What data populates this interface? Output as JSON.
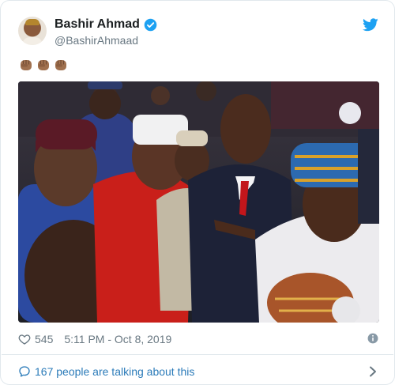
{
  "tweet": {
    "author": {
      "display_name": "Bashir Ahmad",
      "handle": "@BashirAhmaad",
      "verified": true
    },
    "text_emoji": [
      "raised-fist-medium-dark",
      "raised-fist-medium-dark",
      "raised-fist-medium-dark"
    ],
    "likes": "545",
    "timestamp": "5:11 PM - Oct 8, 2019",
    "conversation_label": "167 people are talking about this"
  },
  "colors": {
    "twitter_blue": "#1da1f2",
    "link_blue": "#2b7bb9",
    "meta_gray": "#697882",
    "divider": "#e1e8ed",
    "fist_skin": "#a0714f"
  },
  "icons": {
    "logo": "twitter-bird-icon",
    "verified": "verified-badge-icon",
    "like": "heart-outline-icon",
    "info": "info-circle-icon",
    "conversation": "speech-bubble-icon",
    "more": "chevron-right-icon"
  }
}
